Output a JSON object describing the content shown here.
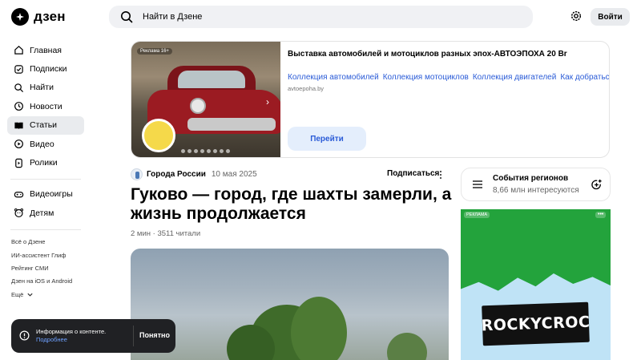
{
  "header": {
    "logo_text": "дзен",
    "search_placeholder": "Найти в Дзене",
    "login_label": "Войти"
  },
  "sidebar": {
    "items": [
      {
        "label": "Главная",
        "icon": "home-icon"
      },
      {
        "label": "Подписки",
        "icon": "subscriptions-icon"
      },
      {
        "label": "Найти",
        "icon": "search-icon"
      },
      {
        "label": "Новости",
        "icon": "news-icon"
      },
      {
        "label": "Статьи",
        "icon": "articles-icon",
        "active": true
      },
      {
        "label": "Видео",
        "icon": "video-icon"
      },
      {
        "label": "Ролики",
        "icon": "shorts-icon"
      }
    ],
    "items2": [
      {
        "label": "Видеоигры",
        "icon": "gamepad-icon"
      },
      {
        "label": "Детям",
        "icon": "kids-icon"
      }
    ],
    "links": [
      "Всё о Дзене",
      "ИИ-ассистент Глиф",
      "Рейтинг СМИ",
      "Дзен на iOS и Android",
      "Ещё"
    ]
  },
  "ad": {
    "badge": "Реклама 16+",
    "title": "Выставка автомобилей и мотоциклов разных эпох-АВТОЭПОХА 20 Br",
    "links": [
      "Коллекция автомобилей",
      "Коллекция мотоциклов",
      "Коллекция двигателей",
      "Как добраться"
    ],
    "domain": "avtoepoha.by",
    "cta": "Перейти"
  },
  "article": {
    "channel": "Города России",
    "date": "10 мая 2025",
    "subscribe": "Подписаться",
    "title": "Гуково — город, где шахты замерли, а жизнь продолжается",
    "meta": "2 мин · 3511 читали"
  },
  "regions": {
    "title": "События регионов",
    "subtitle": "8,66 млн интересуются"
  },
  "promo": {
    "label": "РЕКЛАМА",
    "brand": "ROCKYCROC"
  },
  "toast": {
    "message": "Информация о контенте.",
    "more": "Подробнее",
    "ok": "Понятно"
  }
}
